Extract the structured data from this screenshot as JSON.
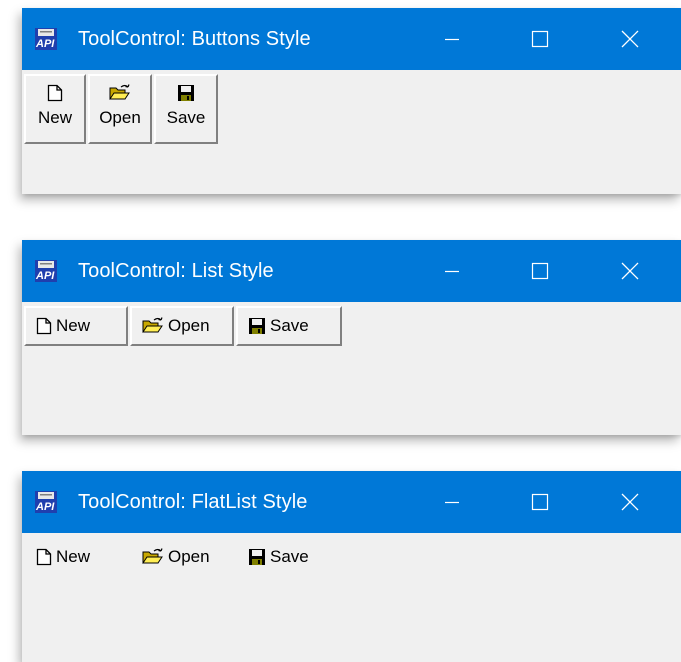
{
  "windows": [
    {
      "title": "ToolControl: Buttons Style",
      "style": "buttons",
      "toolbar": {
        "new_label": "New",
        "open_label": "Open",
        "save_label": "Save"
      }
    },
    {
      "title": "ToolControl: List Style",
      "style": "list",
      "toolbar": {
        "new_label": "New",
        "open_label": "Open",
        "save_label": "Save"
      }
    },
    {
      "title": "ToolControl: FlatList Style",
      "style": "flat-list",
      "toolbar": {
        "new_label": "New",
        "open_label": "Open",
        "save_label": "Save"
      }
    }
  ],
  "caption_buttons": {
    "minimize_icon": "minimize-icon",
    "maximize_icon": "maximize-icon",
    "close_icon": "close-icon"
  },
  "icons": {
    "app": "app-icon",
    "new": "new-document-icon",
    "open": "open-folder-icon",
    "save": "floppy-disk-icon"
  },
  "colors": {
    "titlebar": "#0078d7",
    "client": "#f0f0f0",
    "title_text": "#ffffff"
  },
  "app_icon_text": "API"
}
